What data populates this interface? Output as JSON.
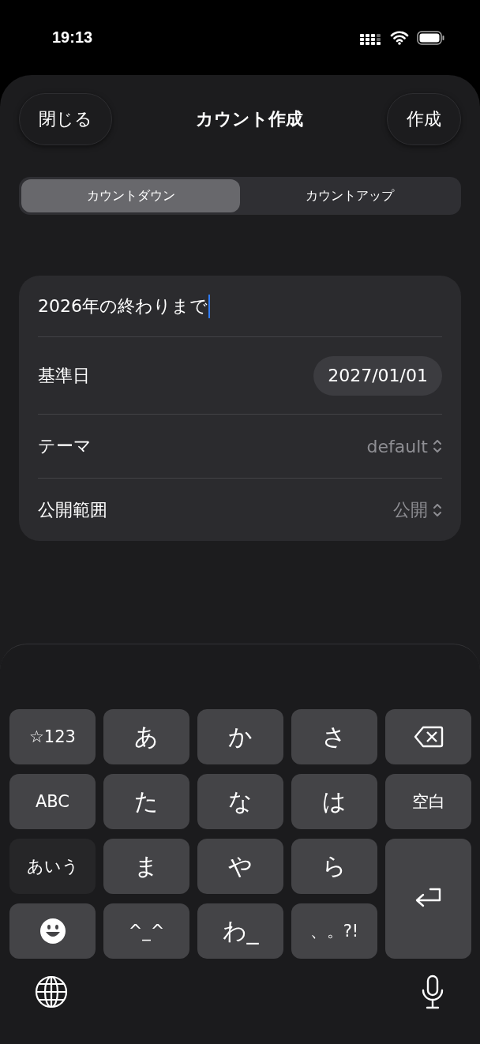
{
  "status_bar": {
    "time": "19:13"
  },
  "header": {
    "close_button": "閉じる",
    "title": "カウント作成",
    "create_button": "作成"
  },
  "segments": [
    {
      "label": "カウントダウン",
      "selected": true
    },
    {
      "label": "カウントアップ",
      "selected": false
    }
  ],
  "form": {
    "title_field": {
      "value": "2026年の終わりまで"
    },
    "rows": [
      {
        "kind": "date",
        "label": "基準日",
        "value": "2027/01/01"
      },
      {
        "kind": "picker",
        "label": "テーマ",
        "value": "default"
      },
      {
        "kind": "picker",
        "label": "公開範囲",
        "value": "公開"
      }
    ]
  },
  "keyboard": {
    "keys": [
      {
        "kind": "mode",
        "label": "☆123",
        "selected": false
      },
      {
        "kind": "char",
        "label": "あ"
      },
      {
        "kind": "char",
        "label": "か"
      },
      {
        "kind": "char",
        "label": "さ"
      },
      {
        "kind": "backspace"
      },
      {
        "kind": "mode",
        "label": "ABC",
        "selected": false
      },
      {
        "kind": "char",
        "label": "た"
      },
      {
        "kind": "char",
        "label": "な"
      },
      {
        "kind": "char",
        "label": "は"
      },
      {
        "kind": "space",
        "label": "空白"
      },
      {
        "kind": "mode",
        "label": "あいう",
        "selected": true
      },
      {
        "kind": "char",
        "label": "ま"
      },
      {
        "kind": "char",
        "label": "や"
      },
      {
        "kind": "char",
        "label": "ら"
      },
      {
        "kind": "enter"
      },
      {
        "kind": "emoji"
      },
      {
        "kind": "symbol",
        "label": "^_^"
      },
      {
        "kind": "char",
        "label": "わ_"
      },
      {
        "kind": "symbol",
        "label": "、。?!"
      }
    ]
  }
}
